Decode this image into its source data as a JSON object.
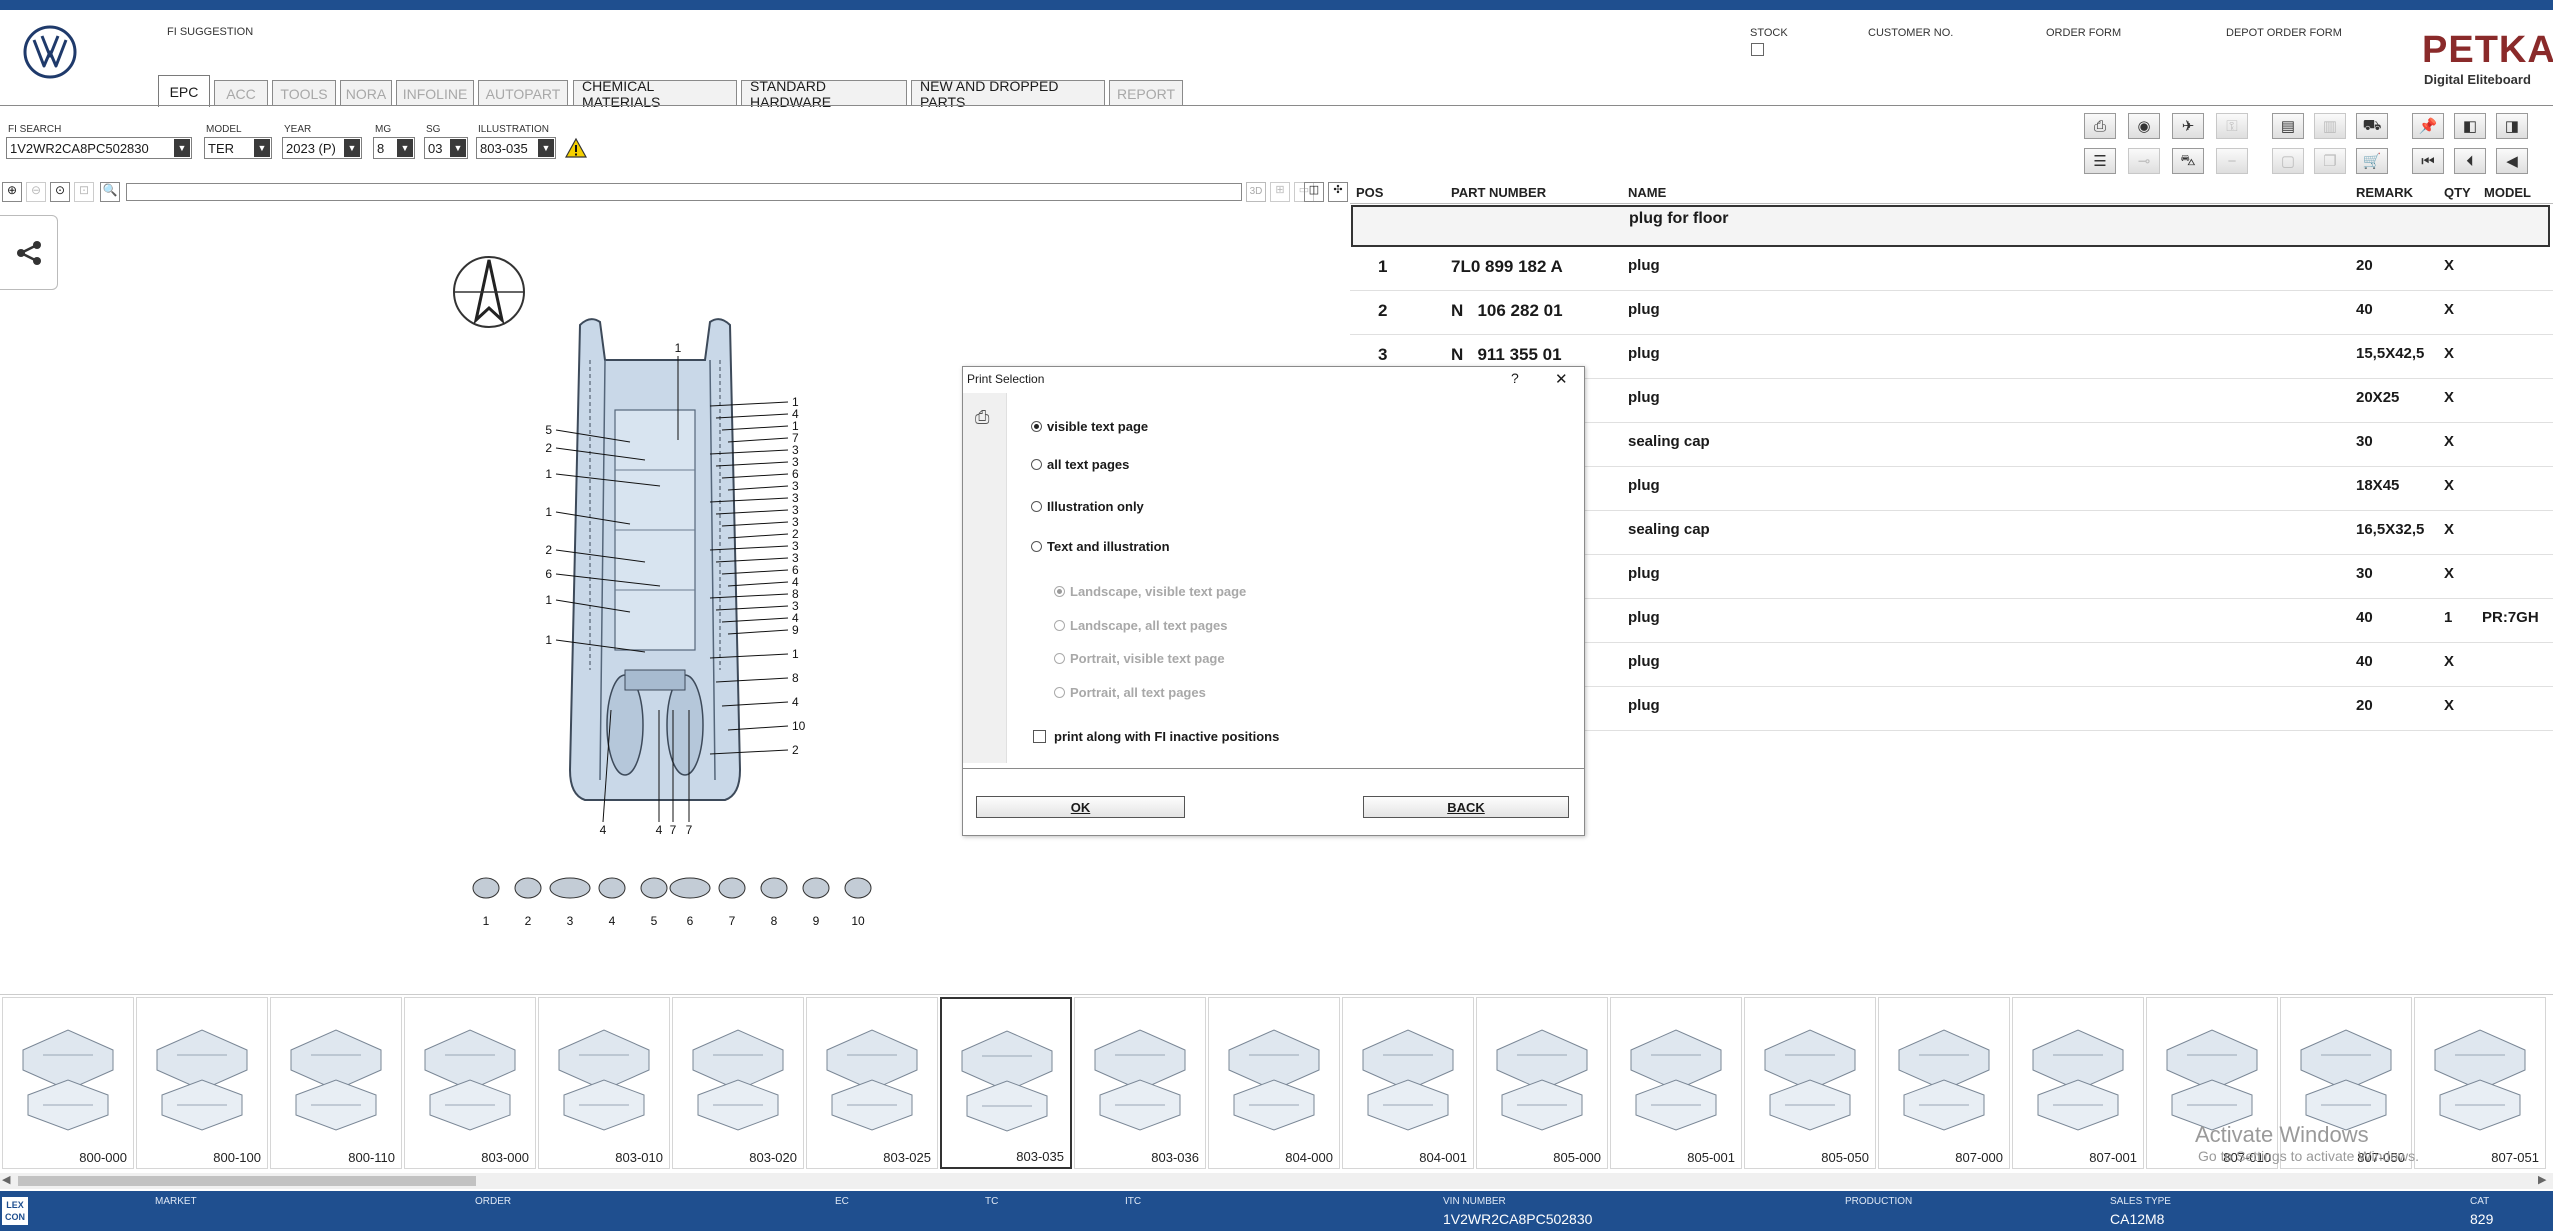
{
  "header": {
    "fi_suggestion": "FI SUGGESTION",
    "stock": "STOCK",
    "customer_no": "CUSTOMER NO.",
    "order_form": "ORDER FORM",
    "depot_order_form": "DEPOT ORDER FORM",
    "brand": "PETKA",
    "brand_sub": "Digital Eliteboard"
  },
  "tabs": [
    {
      "label": "EPC",
      "state": "active"
    },
    {
      "label": "ACC",
      "state": "disabled"
    },
    {
      "label": "TOOLS",
      "state": "disabled"
    },
    {
      "label": "NORA",
      "state": "disabled"
    },
    {
      "label": "INFOLINE",
      "state": "disabled"
    },
    {
      "label": "AUTOPART",
      "state": "disabled"
    },
    {
      "label": "CHEMICAL MATERIALS",
      "state": "enabled"
    },
    {
      "label": "STANDARD HARDWARE",
      "state": "enabled"
    },
    {
      "label": "NEW AND DROPPED PARTS",
      "state": "enabled"
    },
    {
      "label": "REPORT",
      "state": "disabled"
    }
  ],
  "filters": {
    "fi_search_label": "FI SEARCH",
    "fi_search_value": "1V2WR2CA8PC502830",
    "model_label": "MODEL",
    "model_value": "TER",
    "year_label": "YEAR",
    "year_value": "2023 (P)",
    "mg_label": "MG",
    "mg_value": "8",
    "sg_label": "SG",
    "sg_value": "03",
    "illustration_label": "ILLUSTRATION",
    "illustration_value": "803-035"
  },
  "viewer": {
    "btn_3d": "3D"
  },
  "parts_table": {
    "headers": {
      "pos": "POS",
      "part_number": "PART NUMBER",
      "name": "NAME",
      "remark": "REMARK",
      "qty": "QTY",
      "model": "MODEL"
    },
    "group_title": "plug for floor",
    "rows": [
      {
        "pos": "1",
        "part": "7L0 899 182 A",
        "name": "plug",
        "remark": "20",
        "qty": "X",
        "model": ""
      },
      {
        "pos": "2",
        "part": "N   106 282 01",
        "name": "plug",
        "remark": "40",
        "qty": "X",
        "model": ""
      },
      {
        "pos": "3",
        "part": "N   911 355 01",
        "name": "plug",
        "remark": "15,5X42,5",
        "qty": "X",
        "model": ""
      },
      {
        "pos": "",
        "part": "",
        "name": "plug",
        "remark": "20X25",
        "qty": "X",
        "model": ""
      },
      {
        "pos": "",
        "part": "",
        "name": "sealing cap",
        "remark": "30",
        "qty": "X",
        "model": ""
      },
      {
        "pos": "",
        "part": "",
        "name": "plug",
        "remark": "18X45",
        "qty": "X",
        "model": ""
      },
      {
        "pos": "",
        "part": "",
        "name": "sealing cap",
        "remark": "16,5X32,5",
        "qty": "X",
        "model": ""
      },
      {
        "pos": "",
        "part": "",
        "name": "plug",
        "remark": "30",
        "qty": "X",
        "model": ""
      },
      {
        "pos": "",
        "part": "",
        "name": "plug",
        "remark": "40",
        "qty": "1",
        "model": "PR:7GH"
      },
      {
        "pos": "",
        "part": "",
        "name": "plug",
        "remark": "40",
        "qty": "X",
        "model": ""
      },
      {
        "pos": "",
        "part": "",
        "name": "plug",
        "remark": "20",
        "qty": "X",
        "model": ""
      }
    ]
  },
  "dialog": {
    "title": "Print Selection",
    "help": "?",
    "close": "✕",
    "options": [
      "visible text page",
      "all text pages",
      "Illustration only",
      "Text and illustration"
    ],
    "selected_option": 0,
    "sub_options": [
      "Landscape, visible text page",
      "Landscape, all text pages",
      "Portrait, visible text page",
      "Portrait, all text pages"
    ],
    "selected_sub_option": 0,
    "checkbox_label": "print along with FI inactive positions",
    "ok": "OK",
    "back": "BACK"
  },
  "illustration": {
    "callouts_left": [
      "5",
      "2",
      "1",
      "1",
      "2",
      "6",
      "1",
      "1"
    ],
    "callouts_right": [
      "1",
      "4",
      "1",
      "7",
      "3",
      "3",
      "6",
      "3",
      "3",
      "3",
      "3",
      "2",
      "3",
      "3",
      "6",
      "4",
      "8",
      "3",
      "4",
      "9",
      "1",
      "8",
      "4",
      "10",
      "2"
    ],
    "callouts_top": [
      "1"
    ],
    "callouts_bottom": [
      "4",
      "4",
      "7",
      "7"
    ],
    "legend_numbers": [
      "1",
      "2",
      "3",
      "4",
      "5",
      "6",
      "7",
      "8",
      "9",
      "10"
    ]
  },
  "thumbnails": [
    "800-000",
    "800-100",
    "800-110",
    "803-000",
    "803-010",
    "803-020",
    "803-025",
    "803-035",
    "803-036",
    "804-000",
    "804-001",
    "805-000",
    "805-001",
    "805-050",
    "807-000",
    "807-001",
    "807-010",
    "807-050",
    "807-051"
  ],
  "selected_thumbnail": "803-035",
  "watermark": {
    "line1": "Activate Windows",
    "line2": "Go to Settings to activate Windows."
  },
  "statusbar": {
    "logo": "LEX CON",
    "market_label": "MARKET",
    "market_value": "",
    "order_label": "ORDER",
    "order_value": "",
    "ec_label": "EC",
    "ec_value": "",
    "tc_label": "TC",
    "tc_value": "",
    "itc_label": "ITC",
    "itc_value": "",
    "vin_label": "VIN NUMBER",
    "vin_value": "1V2WR2CA8PC502830",
    "production_label": "PRODUCTION",
    "production_value": "",
    "sales_type_label": "SALES TYPE",
    "sales_type_value": "CA12M8",
    "cat_label": "CAT",
    "cat_value": "829"
  },
  "colors": {
    "accent": "#1f4f8f",
    "selection_border": "#333333"
  }
}
